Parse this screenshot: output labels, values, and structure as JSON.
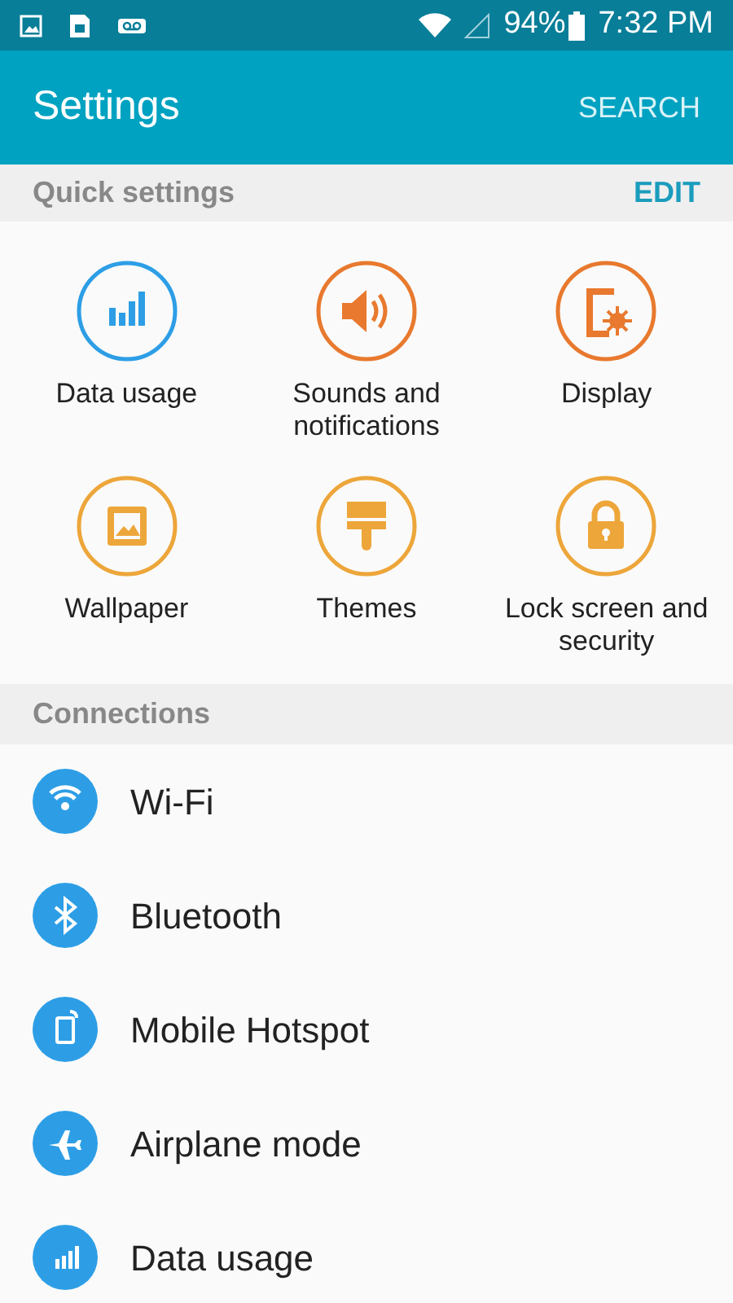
{
  "status_bar": {
    "battery": "94%",
    "time": "7:32 PM"
  },
  "app_bar": {
    "title": "Settings",
    "action": "SEARCH"
  },
  "quick_settings": {
    "header": "Quick settings",
    "action": "EDIT",
    "tiles": [
      {
        "label": "Data usage",
        "color": "#2d9ee6"
      },
      {
        "label": "Sounds and notifications",
        "color": "#e8792e"
      },
      {
        "label": "Display",
        "color": "#e8792e"
      },
      {
        "label": "Wallpaper",
        "color": "#eda63a"
      },
      {
        "label": "Themes",
        "color": "#eda63a"
      },
      {
        "label": "Lock screen and security",
        "color": "#eda63a"
      }
    ]
  },
  "connections": {
    "header": "Connections",
    "items": [
      {
        "label": "Wi-Fi"
      },
      {
        "label": "Bluetooth"
      },
      {
        "label": "Mobile Hotspot"
      },
      {
        "label": "Airplane mode"
      },
      {
        "label": "Data usage"
      }
    ]
  }
}
